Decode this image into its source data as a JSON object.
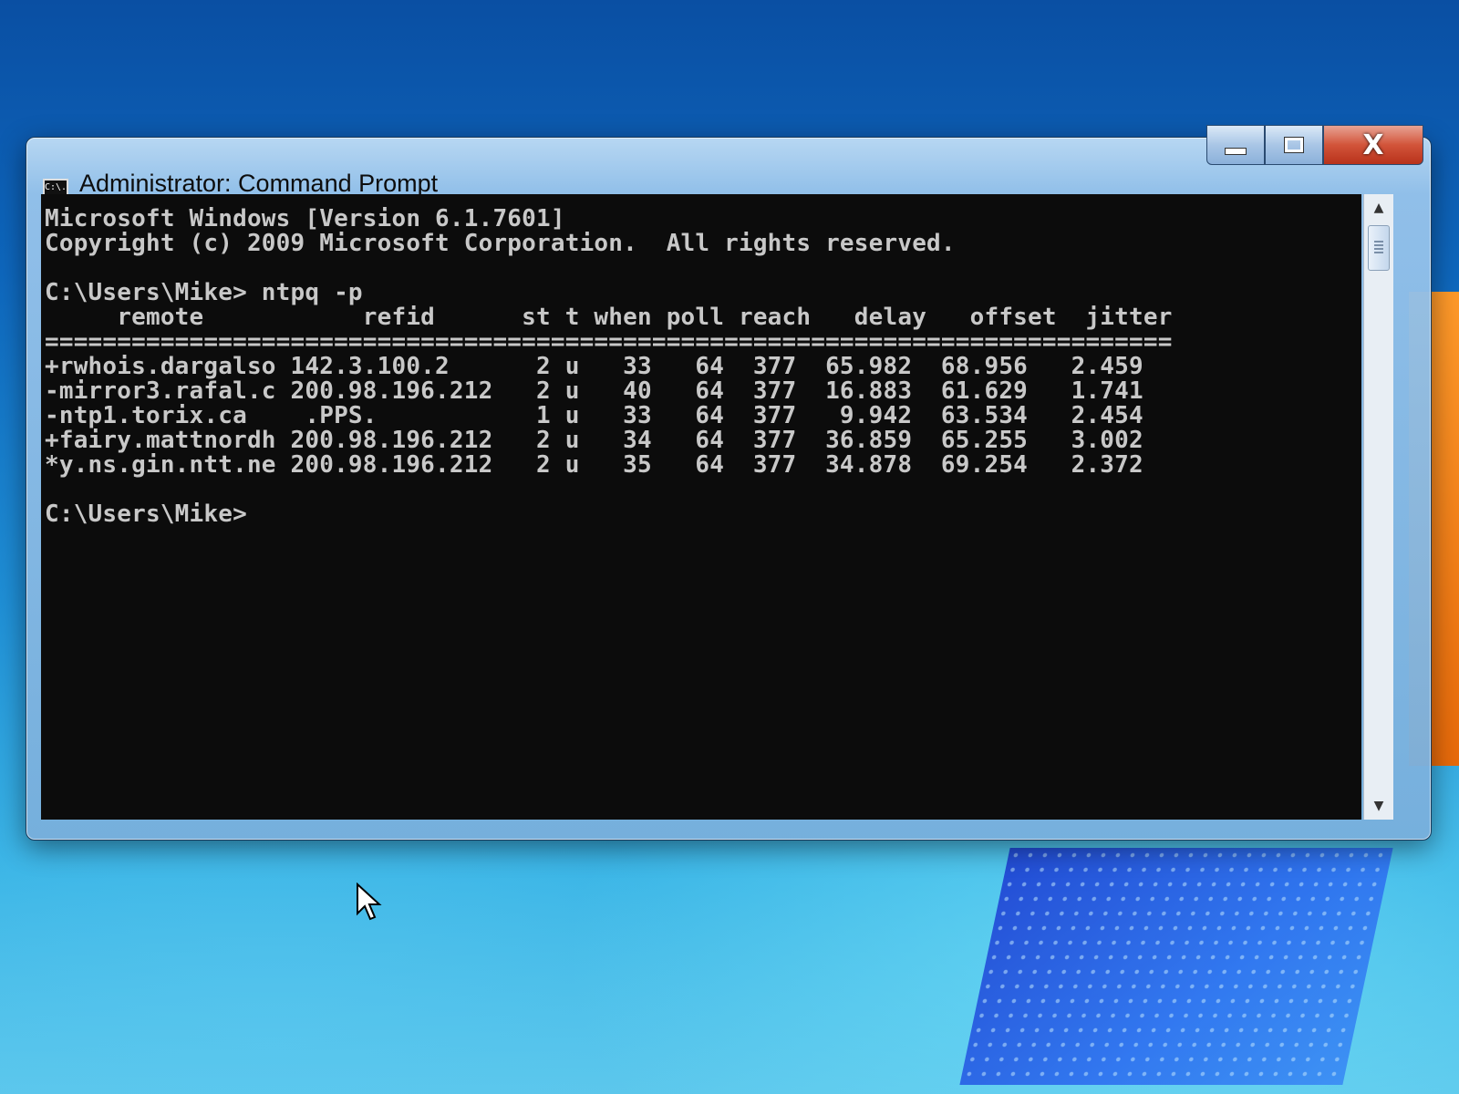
{
  "window": {
    "title": "Administrator: Command Prompt",
    "icon_label": "C:\\."
  },
  "console": {
    "lines": [
      "Microsoft Windows [Version 6.1.7601]",
      "Copyright (c) 2009 Microsoft Corporation.  All rights reserved.",
      "",
      "C:\\Users\\Mike> ntpq -p",
      "     remote           refid      st t when poll reach   delay   offset  jitter",
      "==============================================================================",
      "+rwhois.dargalso 142.3.100.2      2 u   33   64  377  65.982  68.956   2.459",
      "-mirror3.rafal.c 200.98.196.212   2 u   40   64  377  16.883  61.629   1.741",
      "-ntp1.torix.ca    .PPS.           1 u   33   64  377   9.942  63.534   2.454",
      "+fairy.mattnordh 200.98.196.212   2 u   34   64  377  36.859  65.255   3.002",
      "*y.ns.gin.ntt.ne 200.98.196.212   2 u   35   64  377  34.878  69.254   2.372",
      "",
      "C:\\Users\\Mike>"
    ]
  },
  "caption_buttons": {
    "close": "X"
  },
  "icons": {
    "minimize": "minimize-icon",
    "maximize": "maximize-icon",
    "close": "close-icon",
    "scroll_up": "scroll-up-arrow-icon",
    "scroll_down": "scroll-down-arrow-icon",
    "cursor": "mouse-pointer-icon"
  }
}
